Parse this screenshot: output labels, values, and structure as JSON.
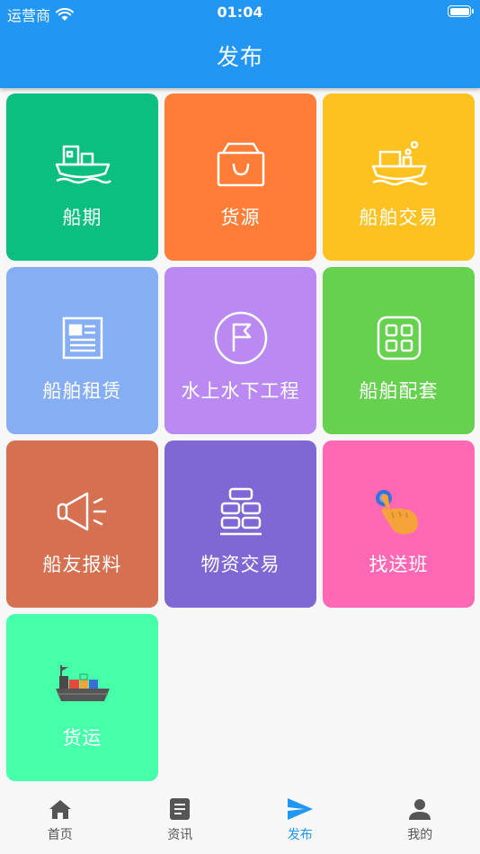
{
  "status_bar": {
    "carrier": "运营商",
    "time": "01:04"
  },
  "header": {
    "title": "发布"
  },
  "tiles": [
    {
      "label": "船期",
      "color": "#0bbf7f",
      "icon": "ship-icon"
    },
    {
      "label": "货源",
      "color": "#ff7d36",
      "icon": "bag-icon"
    },
    {
      "label": "船舶交易",
      "color": "#fdc21f",
      "icon": "ship-trade-icon"
    },
    {
      "label": "船舶租赁",
      "color": "#86aef3",
      "icon": "newspaper-icon"
    },
    {
      "label": "水上水下工程",
      "color": "#ba8af2",
      "icon": "flag-icon"
    },
    {
      "label": "船舶配套",
      "color": "#66d04f",
      "icon": "grid-icon"
    },
    {
      "label": "船友报料",
      "color": "#d57150",
      "icon": "megaphone-icon"
    },
    {
      "label": "物资交易",
      "color": "#7f68d4",
      "icon": "bricks-icon"
    },
    {
      "label": "找送班",
      "color": "#ff68b4",
      "icon": "tap-hand-icon"
    },
    {
      "label": "货运",
      "color": "#46ffa9",
      "icon": "cargo-ship-icon"
    }
  ],
  "tabbar": {
    "items": [
      {
        "label": "首页",
        "icon": "home-icon",
        "active": false
      },
      {
        "label": "资讯",
        "icon": "document-icon",
        "active": false
      },
      {
        "label": "发布",
        "icon": "send-icon",
        "active": true
      },
      {
        "label": "我的",
        "icon": "person-icon",
        "active": false
      }
    ],
    "active_color": "#2196f3"
  }
}
